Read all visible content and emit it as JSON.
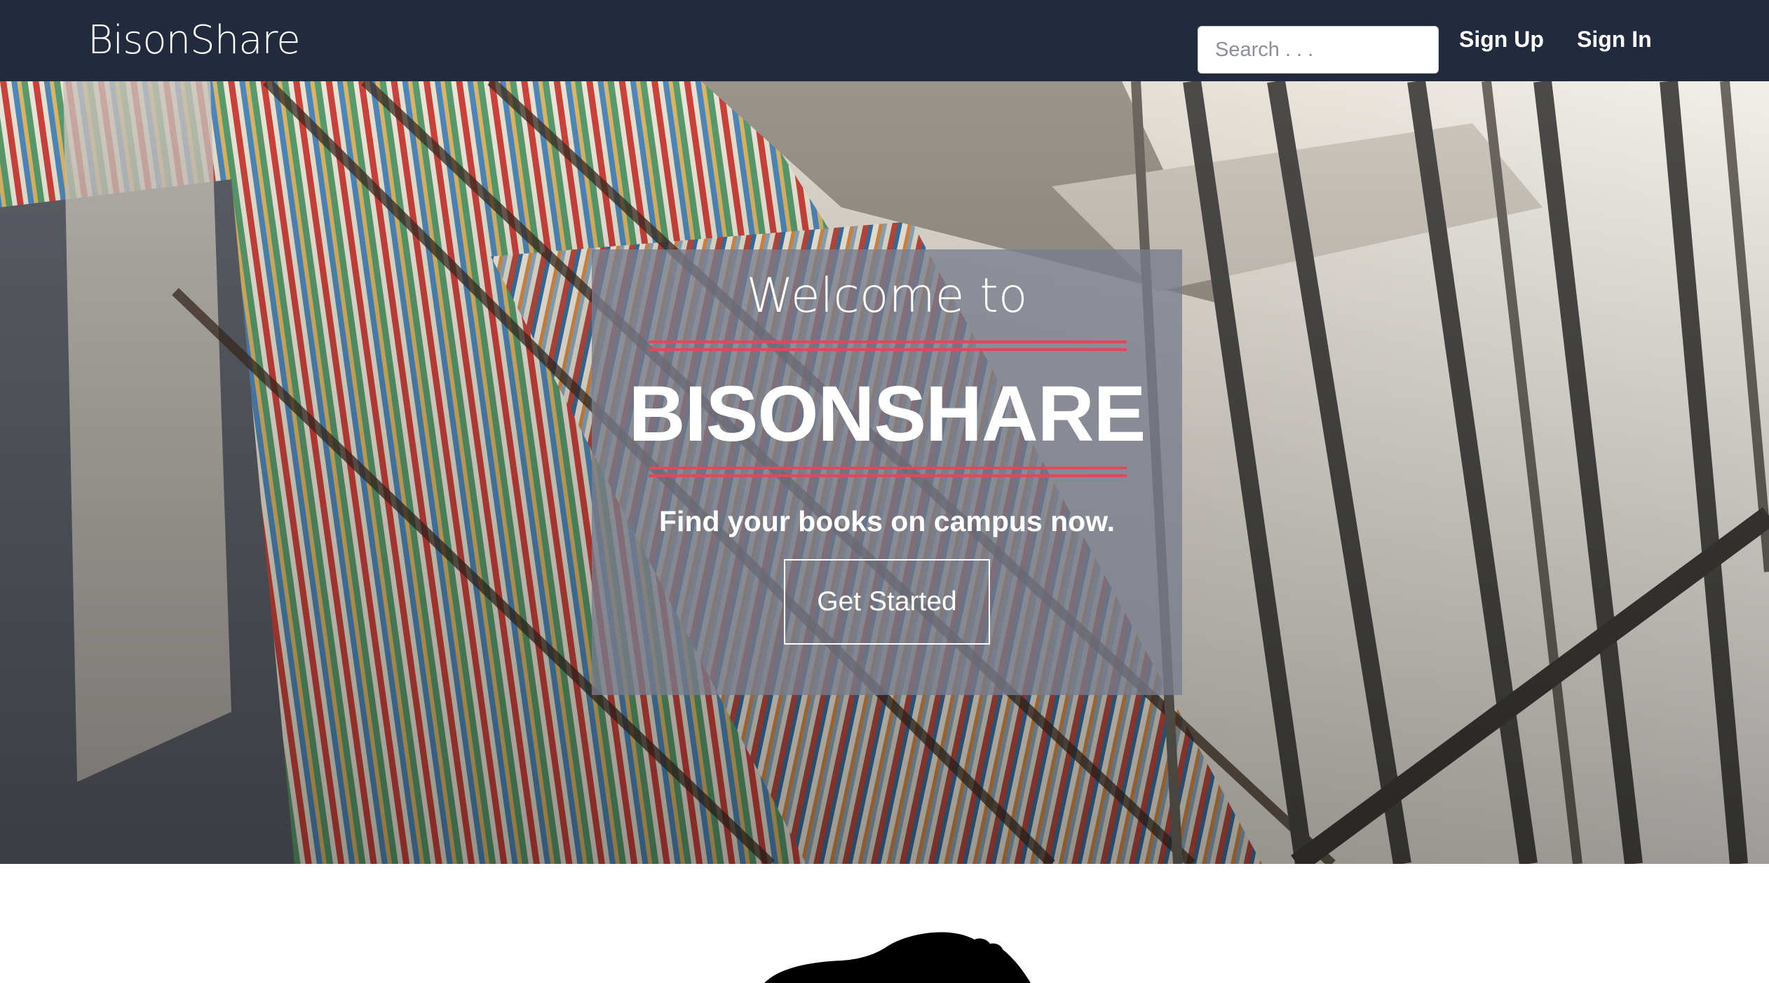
{
  "navbar": {
    "brand": "BisonShare",
    "search": {
      "placeholder": "Search . . .",
      "value": ""
    },
    "links": {
      "sign_up": "Sign Up",
      "sign_in": "Sign In"
    }
  },
  "hero": {
    "welcome": "Welcome to",
    "title": "BISONSHARE",
    "tagline": "Find your books on campus now.",
    "cta_label": "Get Started",
    "background": "library-bookshelves-photo"
  },
  "colors": {
    "navbar_bg": "#222a3d",
    "accent_rule": "#e0495c",
    "overlay": "#787c8c"
  },
  "icons": [
    "bison-silhouette-icon"
  ]
}
